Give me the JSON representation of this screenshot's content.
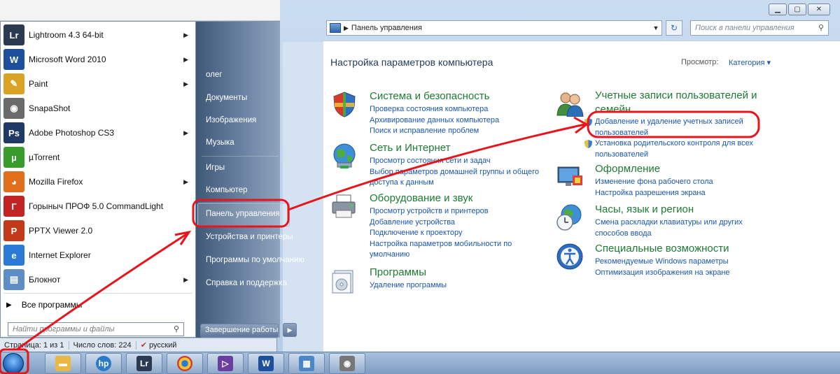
{
  "control_panel": {
    "address": "Панель управления",
    "search_placeholder": "Поиск в панели управления",
    "heading": "Настройка параметров компьютера",
    "view_label": "Просмотр:",
    "view_value": "Категория ▾",
    "categories": [
      {
        "title": "Система и безопасность",
        "links": [
          "Проверка состояния компьютера",
          "Архивирование данных компьютера",
          "Поиск и исправление проблем"
        ]
      },
      {
        "title": "Сеть и Интернет",
        "links": [
          "Просмотр состояния сети и задач",
          "Выбор параметров домашней группы и общего",
          "доступа к данным"
        ]
      },
      {
        "title": "Оборудование и звук",
        "links": [
          "Просмотр устройств и принтеров",
          "Добавление устройства",
          "Подключение к проектору",
          "Настройка параметров мобильности по",
          "умолчанию"
        ]
      },
      {
        "title": "Программы",
        "links": [
          "Удаление программы"
        ]
      },
      {
        "title": "Учетные записи пользователей и семейн...",
        "links": [
          "Добавление и удаление учетных записей",
          "пользователей",
          "Установка родительского контроля для всех",
          "пользователей"
        ]
      },
      {
        "title": "Оформление",
        "links": [
          "Изменение фона рабочего стола",
          "Настройка разрешения экрана"
        ]
      },
      {
        "title": "Часы, язык и регион",
        "links": [
          "Смена раскладки клавиатуры или других",
          "способов ввода"
        ]
      },
      {
        "title": "Специальные возможности",
        "links": [
          "Рекомендуемые Windows параметры",
          "Оптимизация изображения на экране"
        ]
      }
    ]
  },
  "start_menu": {
    "programs": [
      {
        "label": "Lightroom 4.3 64-bit",
        "icon": "Lr",
        "color": "#2b3a52"
      },
      {
        "label": "Microsoft Word 2010",
        "icon": "W",
        "color": "#1d4f9c"
      },
      {
        "label": "Paint",
        "icon": "✎",
        "color": "#d9a326"
      },
      {
        "label": "SnapaShot",
        "icon": "◉",
        "color": "#6b6b6b"
      },
      {
        "label": "Adobe Photoshop CS3",
        "icon": "Ps",
        "color": "#1f3a66"
      },
      {
        "label": "µTorrent",
        "icon": "µ",
        "color": "#3a9b2d"
      },
      {
        "label": "Mozilla Firefox",
        "icon": "◕",
        "color": "#e06e1b"
      },
      {
        "label": "Горыныч ПРОФ 5.0 CommandLight",
        "icon": "Г",
        "color": "#c22424"
      },
      {
        "label": "PPTX Viewer 2.0",
        "icon": "P",
        "color": "#c23a1a"
      },
      {
        "label": "Internet Explorer",
        "icon": "e",
        "color": "#2a7ad5"
      },
      {
        "label": "Блокнот",
        "icon": "▤",
        "color": "#5d8fc6"
      }
    ],
    "all_programs": "Все программы",
    "search_placeholder": "Найти программы и файлы",
    "right_items": [
      "олег",
      "Документы",
      "Изображения",
      "Музыка",
      "Игры",
      "Компьютер",
      "Панель управления",
      "Устройства и принтеры",
      "Программы по умолчанию",
      "Справка и поддержка"
    ],
    "shutdown": "Завершение работы"
  },
  "statusbar": {
    "page": "Страница: 1 из 1",
    "words": "Число слов: 224",
    "lang": "русский"
  },
  "colors": {
    "link": "#1a56b0",
    "category_title": "#1e7b34",
    "annotation": "#e8141c"
  }
}
